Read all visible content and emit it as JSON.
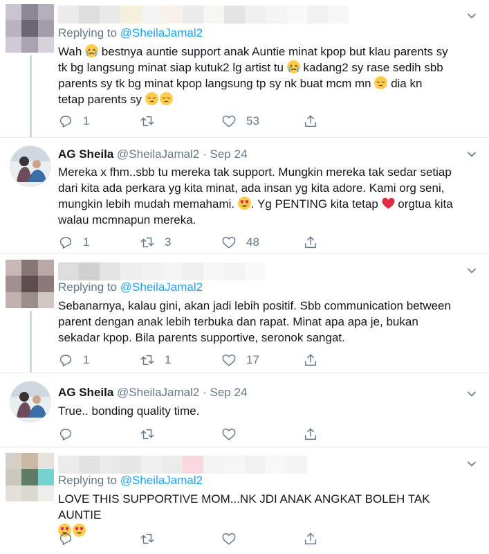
{
  "tweets": [
    {
      "author_name": "",
      "replying_prefix": "Replying to",
      "replying_handle": "@SheilaJamal2",
      "text_lines": [
        "Wah",
        "bestnya auntie support anak Auntie minat kpop but klau parents sy",
        "tk bg langsung minat siap kutuk2 lg artist tu",
        "kadang2 sy rase sedih sbb",
        "parents sy tk bg minat kpop langsung tp sy nk buat mcm mn",
        "dia kn",
        "tetap parents sy"
      ],
      "reply_count": "1",
      "retweet_count": "",
      "like_count": "53"
    },
    {
      "author_name": "AG Sheila",
      "handle": "@SheilaJamal2",
      "separator": "·",
      "date": "Sep 24",
      "text_lines": [
        "Mereka x fhm..sbb tu mereka tak support. Mungkin mereka tak sedar setiap",
        "dari kita ada perkara yg kita minat, ada insan yg kita adore. Kami org seni,",
        "mungkin lebih mudah memahami.",
        ". Yg PENTING kita tetap",
        "orgtua kita",
        "walau mcmnapun mereka."
      ],
      "reply_count": "1",
      "retweet_count": "3",
      "like_count": "48"
    },
    {
      "author_name": "",
      "replying_prefix": "Replying to",
      "replying_handle": "@SheilaJamal2",
      "text_lines": [
        "Sebanarnya, kalau gini, akan jadi lebih positif. Sbb communication between",
        "parent dengan anak lebih terbuka dan rapat. Minat apa apa je, bukan",
        "sekadar kpop. Bila parents supportive, seronok sangat."
      ],
      "reply_count": "1",
      "retweet_count": "1",
      "like_count": "17"
    },
    {
      "author_name": "AG Sheila",
      "handle": "@SheilaJamal2",
      "separator": "·",
      "date": "Sep 24",
      "text_lines": [
        "True.. bonding quality time."
      ],
      "reply_count": "",
      "retweet_count": "",
      "like_count": ""
    },
    {
      "author_name": "",
      "replying_prefix": "Replying to",
      "replying_handle": "@SheilaJamal2",
      "text_lines": [
        "LOVE THIS SUPPORTIVE MOM...NK JDI ANAK ANGKAT BOLEH TAK AUNTIE"
      ],
      "reply_count": "",
      "retweet_count": "",
      "like_count": ""
    }
  ],
  "icons": {
    "reply": "reply-icon",
    "retweet": "retweet-icon",
    "like": "like-icon",
    "share": "share-icon",
    "more": "chevron-down-icon"
  },
  "colors": {
    "link": "#1da1f2",
    "secondary": "#657786",
    "heart": "#e0245e",
    "emoji": "#ffcc4d"
  }
}
